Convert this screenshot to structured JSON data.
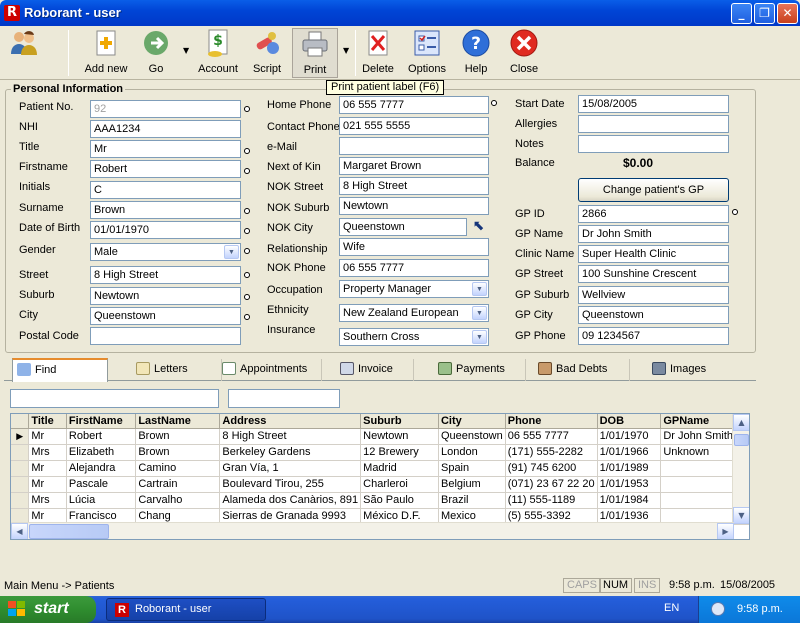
{
  "window": {
    "title": "Roborant - user",
    "app_icon_letter": "R"
  },
  "toolbar": {
    "buttons": [
      {
        "label": ""
      },
      {
        "label": "Add new"
      },
      {
        "label": "Go"
      },
      {
        "label": "Account"
      },
      {
        "label": "Script"
      },
      {
        "label": "Print"
      },
      {
        "label": "Delete"
      },
      {
        "label": "Options"
      },
      {
        "label": "Help"
      },
      {
        "label": "Close"
      }
    ],
    "tooltip": "Print patient label (F6)"
  },
  "personal": {
    "group_title": "Personal Information",
    "patient_no": {
      "label": "Patient No.",
      "value": "92"
    },
    "nhi": {
      "label": "NHI",
      "value": "AAA1234"
    },
    "title": {
      "label": "Title",
      "value": "Mr"
    },
    "firstname": {
      "label": "Firstname",
      "value": "Robert"
    },
    "initials": {
      "label": "Initials",
      "value": "C"
    },
    "surname": {
      "label": "Surname",
      "value": "Brown"
    },
    "dob": {
      "label": "Date of Birth",
      "value": "01/01/1970"
    },
    "gender": {
      "label": "Gender",
      "value": "Male"
    },
    "street": {
      "label": "Street",
      "value": "8 High Street"
    },
    "suburb": {
      "label": "Suburb",
      "value": "Newtown"
    },
    "city": {
      "label": "City",
      "value": "Queenstown"
    },
    "postal_code": {
      "label": "Postal Code",
      "value": ""
    },
    "home_phone": {
      "label": "Home Phone",
      "value": "06 555 7777"
    },
    "contact_phone": {
      "label": "Contact Phone",
      "value": "021 555 5555"
    },
    "email": {
      "label": "e-Mail",
      "value": ""
    },
    "next_of_kin": {
      "label": "Next of Kin",
      "value": "Margaret Brown"
    },
    "nok_street": {
      "label": "NOK Street",
      "value": "8 High Street"
    },
    "nok_suburb": {
      "label": "NOK Suburb",
      "value": "Newtown"
    },
    "nok_city": {
      "label": "NOK City",
      "value": "Queenstown"
    },
    "relationship": {
      "label": "Relationship",
      "value": "Wife"
    },
    "nok_phone": {
      "label": "NOK Phone",
      "value": "06 555 7777"
    },
    "occupation": {
      "label": "Occupation",
      "value": "Property Manager"
    },
    "ethnicity": {
      "label": "Ethnicity",
      "value": "New Zealand European"
    },
    "insurance": {
      "label": "Insurance",
      "value": "Southern Cross"
    },
    "start_date": {
      "label": "Start Date",
      "value": "15/08/2005"
    },
    "allergies": {
      "label": "Allergies",
      "value": ""
    },
    "notes": {
      "label": "Notes",
      "value": ""
    },
    "balance": {
      "label": "Balance",
      "value": "$0.00"
    },
    "change_gp_button": "Change patient's GP",
    "gp_id": {
      "label": "GP ID",
      "value": "2866"
    },
    "gp_name": {
      "label": "GP Name",
      "value": "Dr John Smith"
    },
    "clinic_name": {
      "label": "Clinic Name",
      "value": "Super Health Clinic"
    },
    "gp_street": {
      "label": "GP Street",
      "value": "100 Sunshine Crescent"
    },
    "gp_suburb": {
      "label": "GP Suburb",
      "value": "Wellview"
    },
    "gp_city": {
      "label": "GP City",
      "value": "Queenstown"
    },
    "gp_phone": {
      "label": "GP Phone",
      "value": "09 1234567"
    }
  },
  "tabs": [
    {
      "label": "Find"
    },
    {
      "label": "Letters"
    },
    {
      "label": "Appointments"
    },
    {
      "label": "Invoice"
    },
    {
      "label": "Payments"
    },
    {
      "label": "Bad Debts"
    },
    {
      "label": "Images"
    }
  ],
  "grid": {
    "columns": [
      "Title",
      "FirstName",
      "LastName",
      "Address",
      "Suburb",
      "City",
      "Phone",
      "DOB",
      "GPName"
    ],
    "rows": [
      [
        "Mr",
        "Robert",
        "Brown",
        "8 High Street",
        "Newtown",
        "Queenstown",
        "06 555 7777",
        "1/01/1970",
        "Dr John Smith"
      ],
      [
        "Mrs",
        "Elizabeth",
        "Brown",
        "Berkeley Gardens",
        "12  Brewery",
        "London",
        "(171) 555-2282",
        "1/01/1966",
        "Unknown"
      ],
      [
        "Mr",
        "Alejandra",
        "Camino",
        "Gran Vía, 1",
        "Madrid",
        "Spain",
        "(91) 745 6200",
        "1/01/1989",
        ""
      ],
      [
        "Mr",
        "Pascale",
        "Cartrain",
        "Boulevard Tirou, 255",
        "Charleroi",
        "Belgium",
        "(071) 23 67 22 20",
        "1/01/1953",
        ""
      ],
      [
        "Mrs",
        "Lúcia",
        "Carvalho",
        "Alameda dos Canàrios, 891",
        "São Paulo",
        "Brazil",
        "(11) 555-1189",
        "1/01/1984",
        ""
      ],
      [
        "Mr",
        "Francisco",
        "Chang",
        "Sierras de Granada 9993",
        "México D.F.",
        "Mexico",
        "(5) 555-3392",
        "1/01/1936",
        ""
      ]
    ]
  },
  "status": {
    "breadcrumb": "Main Menu -> Patients",
    "caps": "CAPS",
    "num": "NUM",
    "ins": "INS",
    "time": "9:58 p.m.",
    "date": "15/08/2005"
  },
  "taskbar": {
    "start_label": "start",
    "task_label": "Roborant - user",
    "language": "EN",
    "clock": "9:58 p.m."
  }
}
